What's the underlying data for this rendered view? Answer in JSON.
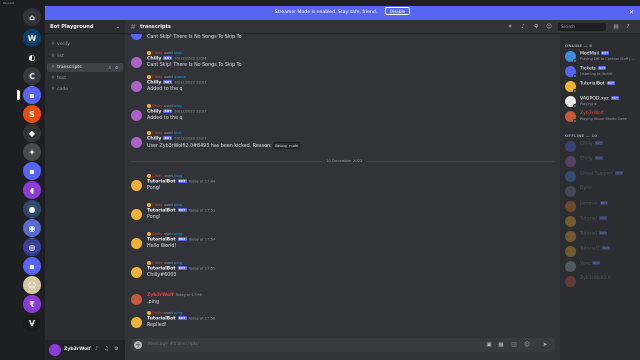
{
  "window": {
    "title": "Discord"
  },
  "banner": {
    "text": "Streamer Mode is enabled. Stay safe, friend.",
    "disable_label": "Disable"
  },
  "guild": {
    "name": "Bot Playground"
  },
  "channels": [
    {
      "name": "verify",
      "active": false
    },
    {
      "name": "list",
      "active": false
    },
    {
      "name": "transcripts",
      "active": true
    },
    {
      "name": "text",
      "active": false
    },
    {
      "name": "code",
      "active": false
    }
  ],
  "chat_header": {
    "channel": "transcripts"
  },
  "search": {
    "placeholder": "Search"
  },
  "messages": [
    {
      "reply_user": "",
      "reply_used": "used",
      "reply_cmd": "",
      "user": "",
      "bot": false,
      "time": "",
      "text": "Cant Skip! There Is No Songs To Skip To",
      "avatar": "#5865f2"
    },
    {
      "reply_user": "Chilly",
      "reply_used": "used",
      "reply_cmd": "skip",
      "user": "Chilly",
      "bot": true,
      "time": "10/12/2022 23:04",
      "text": "Cant Skip! There Is No Songs To Skip To",
      "avatar": "#ad63c9"
    },
    {
      "reply_user": "Chilly",
      "reply_used": "used",
      "reply_cmd": "queue",
      "user": "Chilly",
      "bot": true,
      "time": "10/12/2022 23:07",
      "text": "Added to the q",
      "avatar": "#ad63c9"
    },
    {
      "reply_user": "Chilly",
      "reply_used": "used",
      "reply_cmd": "play",
      "user": "Chilly",
      "bot": true,
      "time": "10/12/2022 23:07",
      "text": "Added to the q",
      "avatar": "#ad63c9"
    },
    {
      "reply_user": "Chilly",
      "reply_used": "used",
      "reply_cmd": "kick",
      "user": "Chilly",
      "bot": true,
      "time": "10/12/2022 23:27",
      "text": "User Zyb3rWolfi2.0#8493 has been kicked. Reason:",
      "code": "Being rude",
      "avatar": "#ad63c9"
    },
    {
      "reply_user": "Chilly",
      "reply_used": "used",
      "reply_cmd": "ping",
      "user": "TutorialBot",
      "bot": true,
      "time": "Today at 17:44",
      "text": "Pong!",
      "avatar": "#f0b232"
    },
    {
      "reply_user": "Chilly",
      "reply_used": "used",
      "reply_cmd": "ping",
      "user": "TutorialBot",
      "bot": true,
      "time": "Today at 17:53",
      "text": "Pong!",
      "avatar": "#f0b232"
    },
    {
      "reply_user": "Chilly",
      "reply_used": "used",
      "reply_cmd": "ping",
      "user": "TutorialBot",
      "bot": true,
      "time": "Today at 17:54",
      "text": "Hello World!",
      "avatar": "#f0b232"
    },
    {
      "reply_user": "Chilly",
      "reply_used": "used",
      "reply_cmd": "ping",
      "user": "TutorialBot",
      "bot": true,
      "time": "Today at 17:55",
      "text": "Chilly#6003",
      "avatar": "#f0b232"
    },
    {
      "reply_user": "",
      "reply_used": "",
      "reply_cmd": "",
      "user": "Zyb3rWolf",
      "bot": false,
      "time": "Today at 17:56",
      "text": ".ping",
      "avatar": "#c45a3a",
      "user_color": "#f23f43"
    },
    {
      "reply_user": "Chilly",
      "reply_used": "used",
      "reply_cmd": "ping",
      "user": "TutorialBot",
      "bot": true,
      "time": "Today at 17:56",
      "text": "Replied!",
      "avatar": "#f0b232"
    }
  ],
  "date_divider": "10 December 2022",
  "composer": {
    "placeholder": "Message #transcripts"
  },
  "members": {
    "online_header": "ONLINE — 6",
    "offline_header": "OFFLINE — 10",
    "online": [
      {
        "name": "ModMail",
        "bot": true,
        "status": "Playing DM to Contact Staff | ...",
        "color": "#ffffff",
        "avatar": "#3b8de0"
      },
      {
        "name": "Tickets",
        "bot": true,
        "status": "Listening to /ticket",
        "color": "#ffffff",
        "avatar": "#5865f2"
      },
      {
        "name": "TutorialBot",
        "bot": true,
        "status": "",
        "color": "#ffffff",
        "avatar": "#f0b232"
      },
      {
        "name": "VAGPOD.xyz",
        "bot": true,
        "status": "Playing ★",
        "color": "#ffffff",
        "avatar": "#e8e8e8"
      },
      {
        "name": "Zyb3rWolf",
        "bot": false,
        "status": "Playing Visual Studio Code",
        "color": "#f23f43",
        "avatar": "#c45a3a"
      }
    ],
    "offline": [
      {
        "name": "Chilly",
        "bot": true
      },
      {
        "name": "Chilly",
        "bot": true
      },
      {
        "name": "Cheat Support",
        "bot": true
      },
      {
        "name": "Dyno",
        "bot": false
      },
      {
        "name": "Jammer",
        "bot": true
      },
      {
        "name": "Tutorial",
        "bot": true
      },
      {
        "name": "Tutorial",
        "bot": true
      },
      {
        "name": "Tutorial2",
        "bot": true
      },
      {
        "name": "Vore",
        "bot": true
      },
      {
        "name": "Zyb3rWolf2.0",
        "bot": false
      }
    ]
  },
  "user": {
    "name": "Zyb3rWolf"
  },
  "colors": {
    "blurple": "#5865f2",
    "online": "#23a55a",
    "danger": "#f23f43"
  }
}
